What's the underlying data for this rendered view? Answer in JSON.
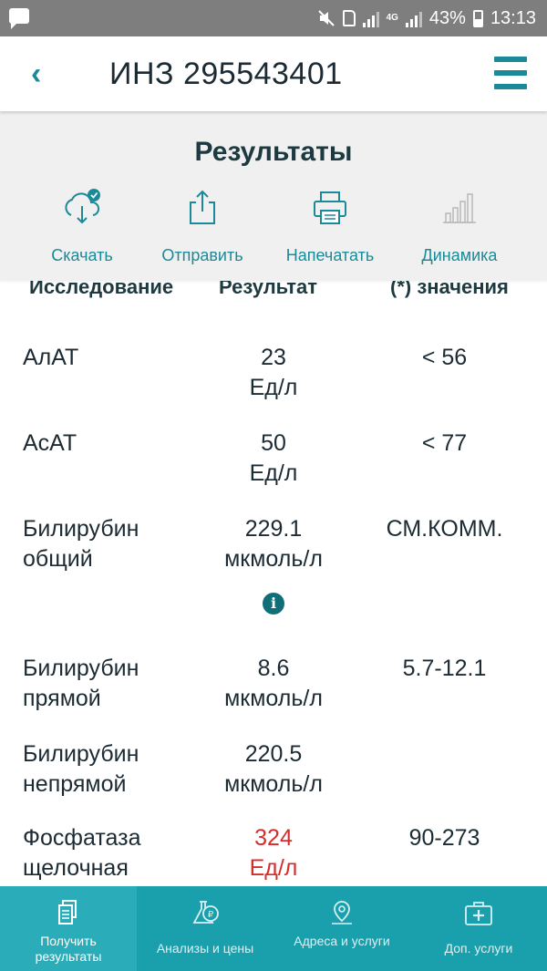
{
  "status_bar": {
    "battery": "43%",
    "time": "13:13",
    "network": "4G",
    "icons": [
      "message-icon",
      "mute-icon",
      "sim-icon",
      "signal-icon",
      "battery-icon"
    ]
  },
  "header": {
    "back_icon": "‹",
    "title": "ИНЗ 295543401",
    "menu_icon": "hamburger-icon"
  },
  "results": {
    "title": "Результаты"
  },
  "toolbar": {
    "items": [
      {
        "label": "Скачать",
        "icon": "cloud-download-icon"
      },
      {
        "label": "Отправить",
        "icon": "share-icon"
      },
      {
        "label": "Напечатать",
        "icon": "printer-icon"
      },
      {
        "label": "Динамика",
        "icon": "bar-chart-icon"
      }
    ]
  },
  "table": {
    "headers": [
      "Исследование",
      "Результат",
      "(*) значения"
    ],
    "rows": [
      {
        "test": "АлАТ",
        "value": "23",
        "unit": "Ед/л",
        "reference": "< 56",
        "abnormal": false
      },
      {
        "test": "АсАТ",
        "value": "50",
        "unit": "Ед/л",
        "reference": "< 77",
        "abnormal": false
      },
      {
        "test": "Билирубин общий",
        "value": "229.1",
        "unit": "мкмоль/л",
        "reference": "СМ.КОММ.",
        "abnormal": false,
        "info": "i"
      },
      {
        "test": "Билирубин прямой",
        "value": "8.6",
        "unit": "мкмоль/л",
        "reference": "5.7-12.1",
        "abnormal": false
      },
      {
        "test": "Билирубин непрямой",
        "value": "220.5",
        "unit": "мкмоль/л",
        "reference": "",
        "abnormal": false
      },
      {
        "test": "Фосфатаза щелочная",
        "value": "324",
        "unit": "Ед/л",
        "reference": "90-273",
        "abnormal": true
      }
    ]
  },
  "bottom_nav": {
    "items": [
      {
        "label": "Получить результаты",
        "icon": "document-icon",
        "active": true
      },
      {
        "label": "Анализы и цены",
        "icon": "flask-icon",
        "active": false
      },
      {
        "label": "Адреса и услуги",
        "icon": "map-pin-icon",
        "active": false
      },
      {
        "label": "Доп. услуги",
        "icon": "medical-kit-icon",
        "active": false
      }
    ]
  },
  "colors": {
    "accent": "#1a8a98",
    "nav_background": "#1aa0ad",
    "abnormal": "#d62c2c",
    "status_bar": "#7e7e7e"
  }
}
